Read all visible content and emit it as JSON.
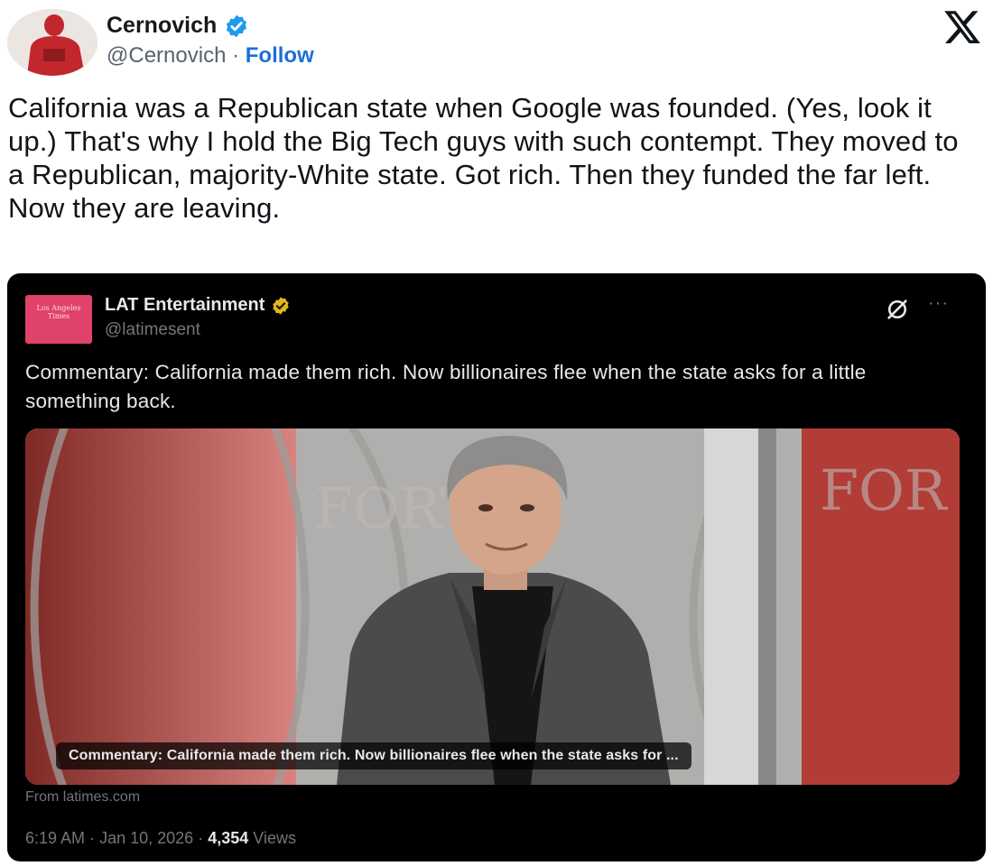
{
  "tweet": {
    "author_name": "Cernovich",
    "handle": "@Cernovich",
    "separator": "·",
    "follow_label": "Follow",
    "text": "California was a Republican state when Google was founded. (Yes, look it up.) That's why I hold the Big Tech guys with such contempt. They moved to a Republican, majority-White state. Got rich. Then they funded the far left. Now they are leaving.",
    "icons": {
      "verified": "verified-badge-icon",
      "platform": "x-logo-icon"
    },
    "colors": {
      "verified": "#1d9bf0",
      "follow": "#1d6fd8"
    }
  },
  "quoted": {
    "author_name": "LAT Entertainment",
    "handle": "@latimesent",
    "logo_text": "Los Angeles Times",
    "text": "Commentary: California made them rich. Now billionaires flee when the state asks for a little something back.",
    "link_card": {
      "caption": "Commentary: California made them rich. Now billionaires flee when the state asks for ...",
      "source": "From latimes.com"
    },
    "time": "6:19 AM",
    "date": "Jan 10, 2026",
    "separator": "·",
    "views_count": "4,354",
    "views_label": "Views",
    "icons": {
      "badge": "gold-verified-badge-icon",
      "grok": "grok-icon",
      "more": "more-options-icon"
    },
    "colors": {
      "logo_bg": "#e0436a",
      "badge": "#e2b719",
      "background": "#000000"
    }
  }
}
